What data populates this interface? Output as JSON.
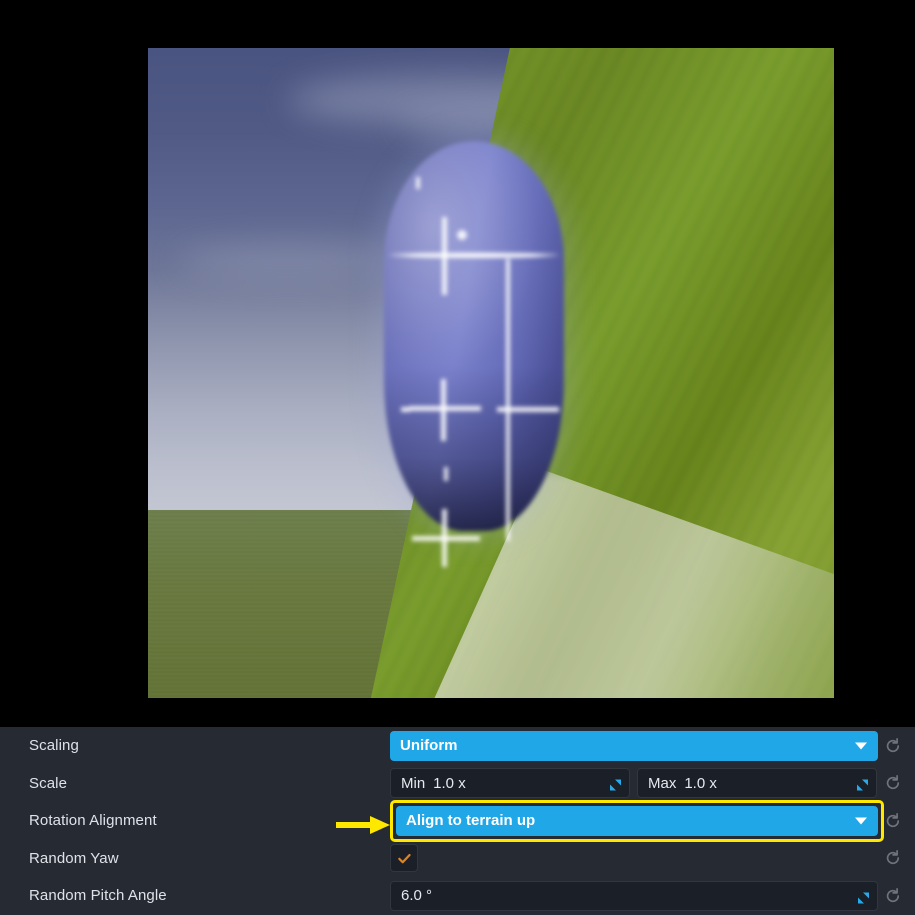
{
  "viewport": {
    "name": "3d-preview-viewport",
    "description": "Blurred 3D scene preview: blue wireframe capsule actor standing on a green terrain slope under a blue-grey sky",
    "sky_color": "#5a6490",
    "ground_color": "#6a7940",
    "hill_color": "#76912e",
    "capsule_color": "#6a70be",
    "wireframe_color": "#ffffff"
  },
  "annotation": {
    "arrow_color": "#ffe800",
    "highlight_color": "#ffe800",
    "target": "rotation-alignment-dropdown"
  },
  "panel": {
    "background": "#262a33",
    "accent_blue": "#20a7e8",
    "checkmark_color": "#e0841f",
    "rows": [
      {
        "label": "Scaling",
        "type": "dropdown",
        "value": "Uniform",
        "highlighted": false,
        "has_reset": true
      },
      {
        "label": "Scale",
        "type": "min-max",
        "min_label": "Min",
        "min_value": "1.0 x",
        "max_label": "Max",
        "max_value": "1.0 x",
        "highlighted": false,
        "has_reset": true
      },
      {
        "label": "Rotation Alignment",
        "type": "dropdown",
        "value": "Align to terrain up",
        "highlighted": true,
        "has_reset": true
      },
      {
        "label": "Random Yaw",
        "type": "checkbox",
        "checked": true,
        "highlighted": false,
        "has_reset": true
      },
      {
        "label": "Random Pitch Angle",
        "type": "number",
        "value": "6.0 °",
        "highlighted": false,
        "has_reset": true
      }
    ]
  },
  "icons": {
    "caret_down": "chevron-down-icon",
    "reset": "reset-arrow-icon",
    "drag_slider": "drag-slider-icon",
    "check": "check-icon"
  }
}
